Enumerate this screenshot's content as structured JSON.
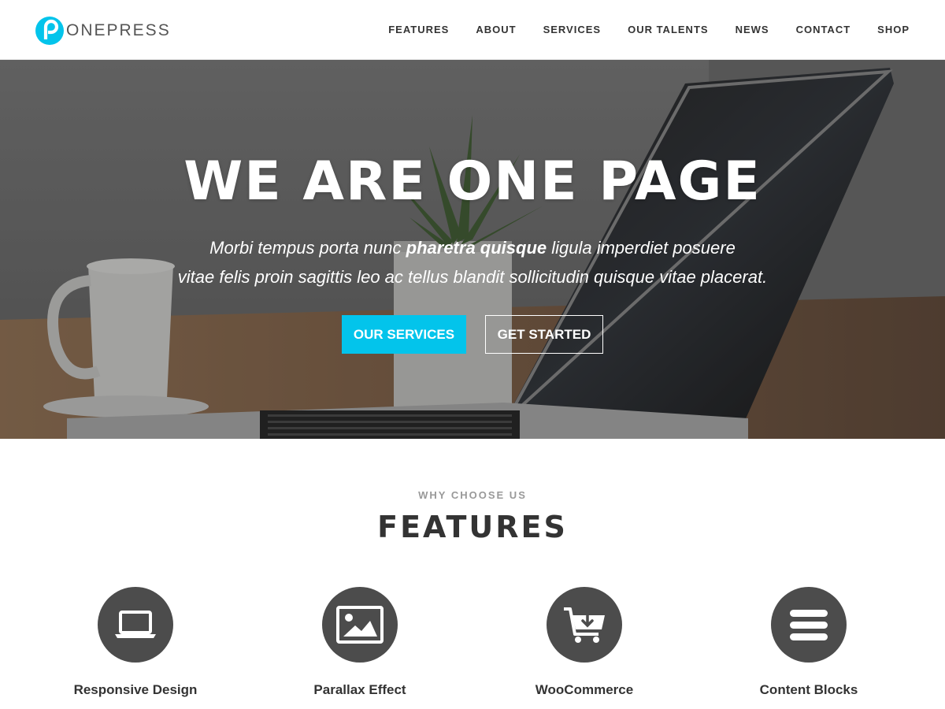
{
  "header": {
    "logo_text": "ONEPRESS",
    "nav": [
      "FEATURES",
      "ABOUT",
      "SERVICES",
      "OUR TALENTS",
      "NEWS",
      "CONTACT",
      "SHOP"
    ]
  },
  "hero": {
    "title": "WE ARE ONE PAGE",
    "subtitle_part1": "Morbi tempus porta nunc ",
    "subtitle_bold": "pharetra quisque",
    "subtitle_part2": " ligula imperdiet posuere",
    "subtitle_line2": "vitae felis proin sagittis leo ac tellus blandit sollicitudin quisque vitae placerat.",
    "primary_button": "OUR SERVICES",
    "secondary_button": "GET STARTED"
  },
  "features": {
    "subtitle": "WHY CHOOSE US",
    "title": "FEATURES",
    "items": [
      {
        "name": "Responsive Design",
        "icon": "laptop-icon"
      },
      {
        "name": "Parallax Effect",
        "icon": "image-icon"
      },
      {
        "name": "WooCommerce",
        "icon": "cart-download-icon"
      },
      {
        "name": "Content Blocks",
        "icon": "bars-icon"
      }
    ]
  },
  "colors": {
    "accent": "#03c4eb",
    "icon_circle": "#4c4c4c",
    "text": "#333333"
  }
}
